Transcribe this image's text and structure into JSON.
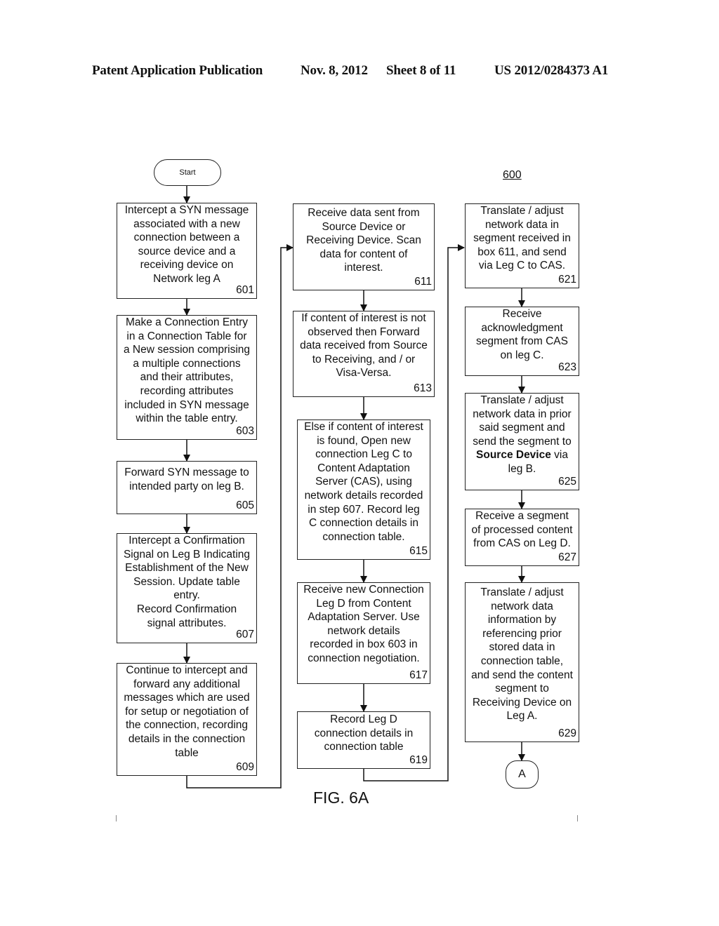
{
  "header": {
    "publication": "Patent Application Publication",
    "date": "Nov. 8, 2012",
    "sheet": "Sheet 8 of 11",
    "number": "US 2012/0284373 A1"
  },
  "diagram": {
    "reference": "600",
    "figure_label": "FIG. 6A",
    "start_label": "Start",
    "connector_label": "A",
    "steps": {
      "s601": {
        "text": "Intercept a SYN message\nassociated with a new\nconnection between a\nsource device and a\nreceiving device on\nNetwork leg A",
        "num": "601"
      },
      "s603": {
        "text": "Make a Connection Entry\nin a Connection Table for\na New session comprising\na multiple connections\nand their attributes,\nrecording attributes\nincluded in SYN message\nwithin the table entry.",
        "num": "603"
      },
      "s605": {
        "text": "Forward SYN message to\nintended party on leg B.",
        "num": "605"
      },
      "s607": {
        "text": "Intercept a Confirmation\nSignal on Leg B Indicating\nEstablishment of the New\nSession. Update table\nentry.\nRecord Confirmation\nsignal attributes.",
        "num": "607"
      },
      "s609": {
        "text": "Continue to intercept and\nforward any additional\nmessages which are used\nfor setup or negotiation  of\nthe connection, recording\ndetails in the connection\ntable",
        "num": "609"
      },
      "s611": {
        "text": "Receive data sent from\nSource Device or\nReceiving Device. Scan\ndata for content of\ninterest.",
        "num": "611"
      },
      "s613": {
        "text": "If content of interest is not\nobserved then Forward\ndata received from Source\nto Receiving, and / or\nVisa-Versa.",
        "num": "613"
      },
      "s615": {
        "text": "Else if content of interest\nis found, Open new\nconnection Leg C to\nContent Adaptation\nServer (CAS), using\nnetwork details recorded\nin step 607.  Record leg\nC connection details in\nconnection table.",
        "num": "615"
      },
      "s617": {
        "text": "Receive new Connection\nLeg D from Content\nAdaptation Server. Use\nnetwork  details\nrecorded in box 603 in\nconnection negotiation.",
        "num": "617"
      },
      "s619": {
        "text": "Record Leg D\nconnection details in\nconnection table",
        "num": "619"
      },
      "s621": {
        "text": "Translate / adjust\nnetwork data in\nsegment received in\nbox 611, and send\nvia Leg C to CAS.",
        "num": "621"
      },
      "s623": {
        "text": "Receive\nacknowledgment\nsegment from CAS\non leg C.",
        "num": "623"
      },
      "s625": {
        "text_before": "Translate / adjust\nnetwork data in prior\nsaid segment  and\nsend the segment to\n",
        "text_bold": "Source Device",
        "text_after": " via\nleg B.",
        "num": "625"
      },
      "s627": {
        "text": "Receive a segment\nof processed content\nfrom CAS on Leg D.",
        "num": "627"
      },
      "s629": {
        "text": "Translate / adjust\nnetwork data\ninformation by\nreferencing prior\nstored data in\nconnection table,\nand send the content\nsegment to\nReceiving Device on\nLeg A.",
        "num": "629"
      }
    }
  }
}
